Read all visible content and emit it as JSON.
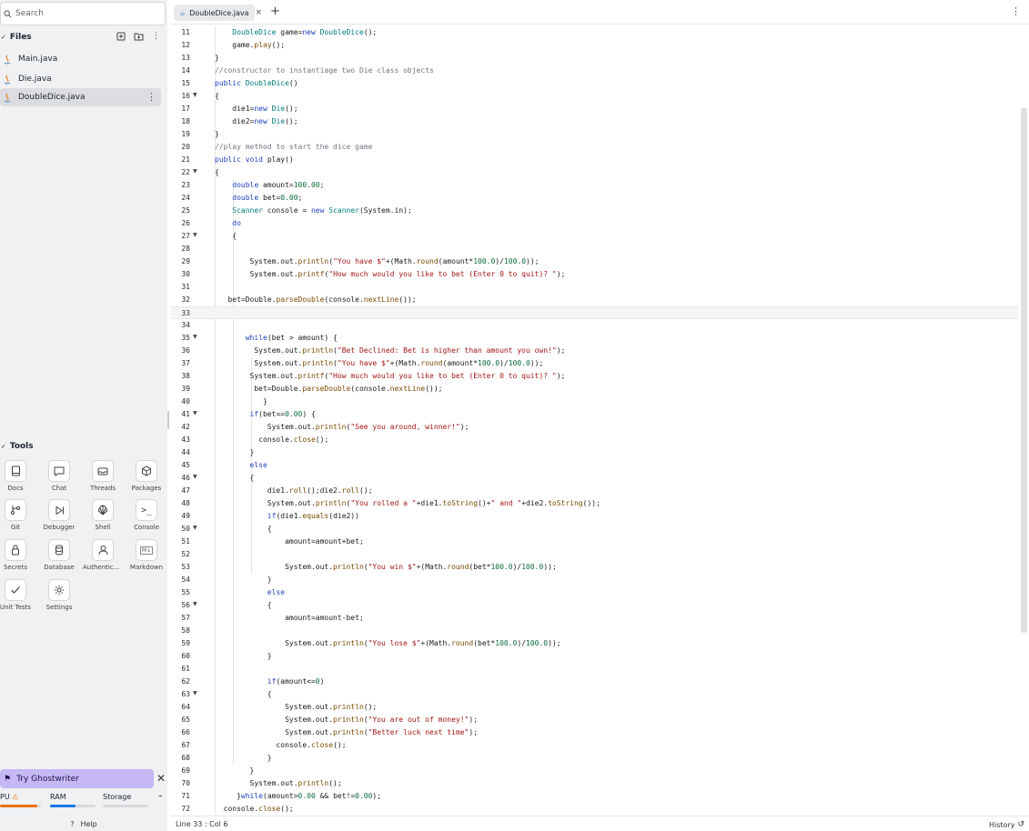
{
  "sidebar": {
    "search_placeholder": "Search",
    "files_title": "Files",
    "files": [
      {
        "name": "Main.java"
      },
      {
        "name": "Die.java"
      },
      {
        "name": "DoubleDice.java"
      }
    ],
    "tools_title": "Tools",
    "tools": [
      {
        "label": "Docs",
        "icon": "book-icon"
      },
      {
        "label": "Chat",
        "icon": "chat-icon"
      },
      {
        "label": "Threads",
        "icon": "inbox-icon"
      },
      {
        "label": "Packages",
        "icon": "cube-icon"
      },
      {
        "label": "Git",
        "icon": "git-icon"
      },
      {
        "label": "Debugger",
        "icon": "debugger-icon"
      },
      {
        "label": "Shell",
        "icon": "shell-icon"
      },
      {
        "label": "Console",
        "icon": "console-icon"
      },
      {
        "label": "Secrets",
        "icon": "lock-icon"
      },
      {
        "label": "Database",
        "icon": "database-icon"
      },
      {
        "label": "Authenticat...",
        "icon": "user-icon"
      },
      {
        "label": "Markdown",
        "icon": "markdown-icon"
      },
      {
        "label": "Unit Tests",
        "icon": "check-icon"
      },
      {
        "label": "Settings",
        "icon": "gear-icon"
      }
    ],
    "ghostwriter_label": "Try Ghostwriter",
    "resources": {
      "cpu_label": "PU",
      "ram_label": "RAM",
      "storage_label": "Storage",
      "cpu_fraction": 0.9,
      "ram_fraction": 0.55,
      "storage_fraction": 0.0,
      "cpu_color": "#e8710a",
      "ram_color": "#1a73e8"
    },
    "help_label": "Help"
  },
  "editor": {
    "tab_label": "DoubleDice.java",
    "status": "Line 33 : Col 6",
    "history_label": "History",
    "lines": [
      {
        "n": "11",
        "fold": false,
        "text": "    DoubleDice game=new DoubleDice();"
      },
      {
        "n": "12",
        "fold": false,
        "text": "    game.play();"
      },
      {
        "n": "13",
        "fold": false,
        "text": "}"
      },
      {
        "n": "14",
        "fold": false,
        "text": "//constructor to instantiage two Die class objects"
      },
      {
        "n": "15",
        "fold": false,
        "text": "public DoubleDice()"
      },
      {
        "n": "16",
        "fold": true,
        "text": "{"
      },
      {
        "n": "17",
        "fold": false,
        "text": "    die1=new Die();"
      },
      {
        "n": "18",
        "fold": false,
        "text": "    die2=new Die();"
      },
      {
        "n": "19",
        "fold": false,
        "text": "}"
      },
      {
        "n": "20",
        "fold": false,
        "text": "//play method to start the dice game"
      },
      {
        "n": "21",
        "fold": false,
        "text": "public void play()"
      },
      {
        "n": "22",
        "fold": true,
        "text": "{"
      },
      {
        "n": "23",
        "fold": false,
        "text": "    double amount=100.00;"
      },
      {
        "n": "24",
        "fold": false,
        "text": "    double bet=0.00;"
      },
      {
        "n": "25",
        "fold": false,
        "text": "    Scanner console = new Scanner(System.in);"
      },
      {
        "n": "26",
        "fold": false,
        "text": "    do"
      },
      {
        "n": "27",
        "fold": true,
        "text": "    {"
      },
      {
        "n": "28",
        "fold": false,
        "text": ""
      },
      {
        "n": "29",
        "fold": false,
        "text": "        System.out.println(\"You have $\"+(Math.round(amount*100.0)/100.0));"
      },
      {
        "n": "30",
        "fold": false,
        "text": "        System.out.printf(\"How much would you like to bet (Enter 0 to quit)? \");"
      },
      {
        "n": "31",
        "fold": false,
        "text": ""
      },
      {
        "n": "32",
        "fold": false,
        "text": "   bet=Double.parseDouble(console.nextLine());"
      },
      {
        "n": "33",
        "fold": false,
        "text": ""
      },
      {
        "n": "34",
        "fold": false,
        "text": ""
      },
      {
        "n": "35",
        "fold": true,
        "text": "       while(bet > amount) {"
      },
      {
        "n": "36",
        "fold": false,
        "text": "         System.out.println(\"Bet Declined: Bet is higher than amount you own!\");"
      },
      {
        "n": "37",
        "fold": false,
        "text": "         System.out.println(\"You have $\"+(Math.round(amount*100.0)/100.0));"
      },
      {
        "n": "38",
        "fold": false,
        "text": "        System.out.printf(\"How much would you like to bet (Enter 0 to quit)? \");"
      },
      {
        "n": "39",
        "fold": false,
        "text": "         bet=Double.parseDouble(console.nextLine());"
      },
      {
        "n": "40",
        "fold": false,
        "text": "           }"
      },
      {
        "n": "41",
        "fold": true,
        "text": "        if(bet==0.00) {"
      },
      {
        "n": "42",
        "fold": false,
        "text": "            System.out.println(\"See you around, winner!\");"
      },
      {
        "n": "43",
        "fold": false,
        "text": "          console.close();"
      },
      {
        "n": "44",
        "fold": false,
        "text": "        }"
      },
      {
        "n": "45",
        "fold": false,
        "text": "        else"
      },
      {
        "n": "46",
        "fold": true,
        "text": "        {"
      },
      {
        "n": "47",
        "fold": false,
        "text": "            die1.roll();die2.roll();"
      },
      {
        "n": "48",
        "fold": false,
        "text": "            System.out.println(\"You rolled a \"+die1.toString()+\" and \"+die2.toString());"
      },
      {
        "n": "49",
        "fold": false,
        "text": "            if(die1.equals(die2))"
      },
      {
        "n": "50",
        "fold": true,
        "text": "            {"
      },
      {
        "n": "51",
        "fold": false,
        "text": "                amount=amount+bet;"
      },
      {
        "n": "52",
        "fold": false,
        "text": ""
      },
      {
        "n": "53",
        "fold": false,
        "text": "                System.out.println(\"You win $\"+(Math.round(bet*100.0)/100.0));"
      },
      {
        "n": "54",
        "fold": false,
        "text": "            }"
      },
      {
        "n": "55",
        "fold": false,
        "text": "            else"
      },
      {
        "n": "56",
        "fold": true,
        "text": "            {"
      },
      {
        "n": "57",
        "fold": false,
        "text": "                amount=amount-bet;"
      },
      {
        "n": "58",
        "fold": false,
        "text": ""
      },
      {
        "n": "59",
        "fold": false,
        "text": "                System.out.println(\"You lose $\"+(Math.round(bet*100.0)/100.0));"
      },
      {
        "n": "60",
        "fold": false,
        "text": "            }"
      },
      {
        "n": "61",
        "fold": false,
        "text": ""
      },
      {
        "n": "62",
        "fold": false,
        "text": "            if(amount<=0)"
      },
      {
        "n": "63",
        "fold": true,
        "text": "            {"
      },
      {
        "n": "64",
        "fold": false,
        "text": "                System.out.println();"
      },
      {
        "n": "65",
        "fold": false,
        "text": "                System.out.println(\"You are out of money!\");"
      },
      {
        "n": "66",
        "fold": false,
        "text": "                System.out.println(\"Better luck next time\");"
      },
      {
        "n": "67",
        "fold": false,
        "text": "              console.close();"
      },
      {
        "n": "68",
        "fold": false,
        "text": "            }"
      },
      {
        "n": "69",
        "fold": false,
        "text": "        }"
      },
      {
        "n": "70",
        "fold": false,
        "text": "        System.out.println();"
      },
      {
        "n": "71",
        "fold": false,
        "text": "     }while(amount>0.00 && bet!=0.00);"
      },
      {
        "n": "72",
        "fold": false,
        "text": "  console.close();"
      }
    ],
    "current_line": "33"
  }
}
